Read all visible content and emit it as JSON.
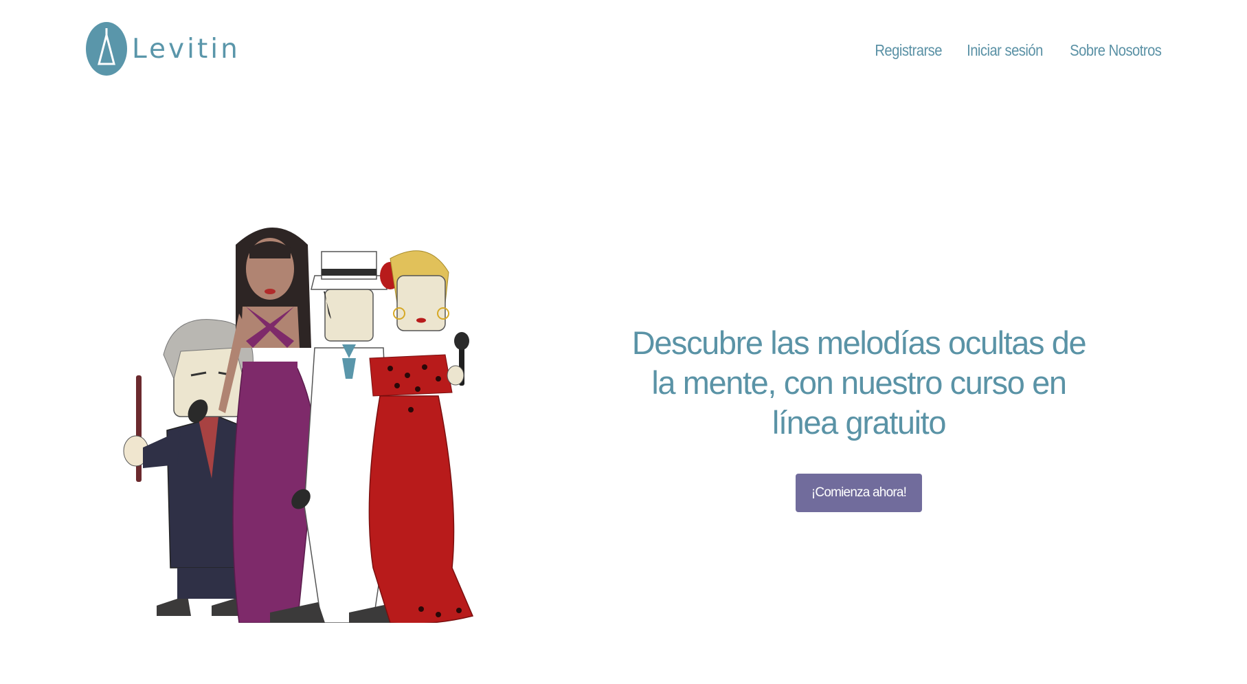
{
  "brand": {
    "name": "Levitin",
    "logo_icon": "tuning-fork-icon",
    "color": "#5a96aa"
  },
  "nav": {
    "items": [
      {
        "label": "Registrarse"
      },
      {
        "label": "Iniciar sesión"
      },
      {
        "label": "Sobre Nosotros"
      }
    ]
  },
  "hero": {
    "illustration": "music-legends-illustration",
    "headline": "Descubre las melodías ocultas de la mente, con nuestro curso en línea gratuito",
    "cta_label": "¡Comienza ahora!",
    "cta_color": "#716c9c"
  }
}
